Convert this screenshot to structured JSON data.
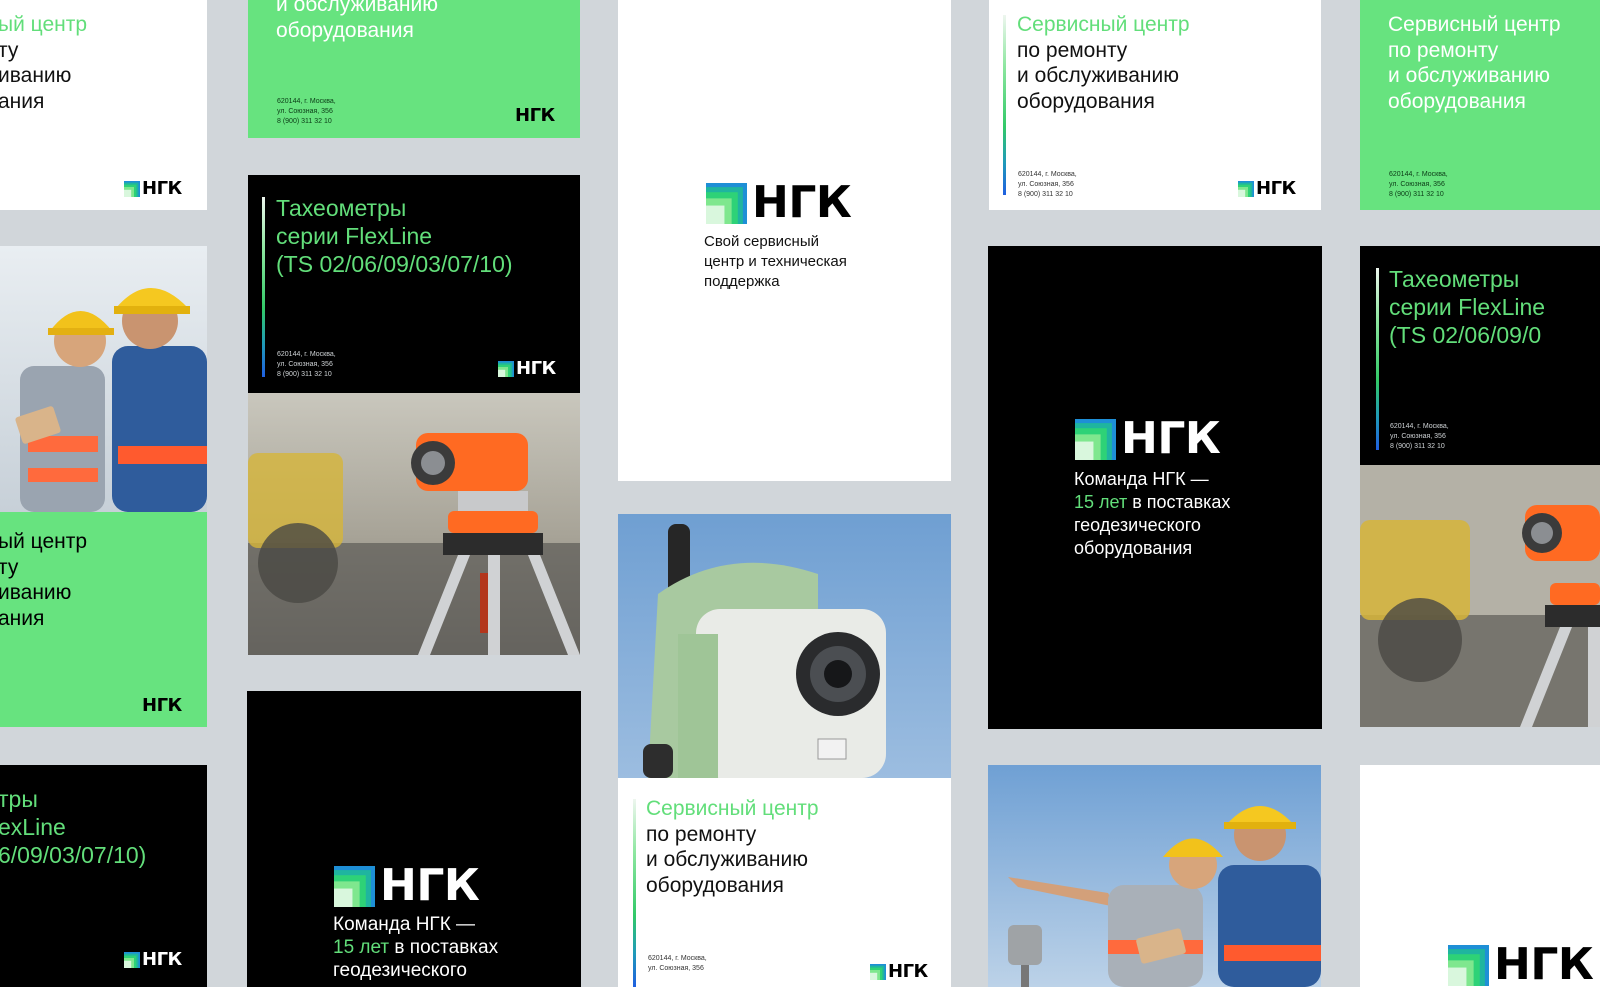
{
  "brand": {
    "name": "НГК",
    "colors": {
      "green": "#67e37f",
      "black": "#000000",
      "white": "#ffffff",
      "accent_text": "#62de7a",
      "background": "#d1d6da"
    }
  },
  "service": {
    "title_line1": "Сервисный центр",
    "title_line2": "по ремонту",
    "title_line3": "и обслуживанию",
    "title_line4": "оборудования"
  },
  "service_crop_left": {
    "line1": "ый центр",
    "line2": "ту",
    "line3": "иванию",
    "line4": "ания"
  },
  "flexline": {
    "line1": "Тахеометры",
    "line2": "серии FlexLine",
    "line3": "(TS 02/06/09/03/07/10)"
  },
  "flexline_crop_left": {
    "line1": "тры",
    "line2": "exLine",
    "line3": "6/09/03/07/10)"
  },
  "flexline_crop_right": {
    "line3": "(TS 02/06/09/0"
  },
  "address": {
    "line1": "620144, г. Москва,",
    "line2": "ул. Союзная, 356",
    "line3": "8 (900) 311 32 10"
  },
  "tagline": {
    "line1": "Свой сервисный",
    "line2": "центр и техническая",
    "line3": "поддержка"
  },
  "team": {
    "line1": "Команда НГК —",
    "line2_highlight": "15 лет",
    "line2_rest": " в поставках",
    "line3": "геодезического",
    "line4": "оборудования"
  },
  "icons": {
    "logo_mark": "ngk-logo-mark-icon"
  }
}
